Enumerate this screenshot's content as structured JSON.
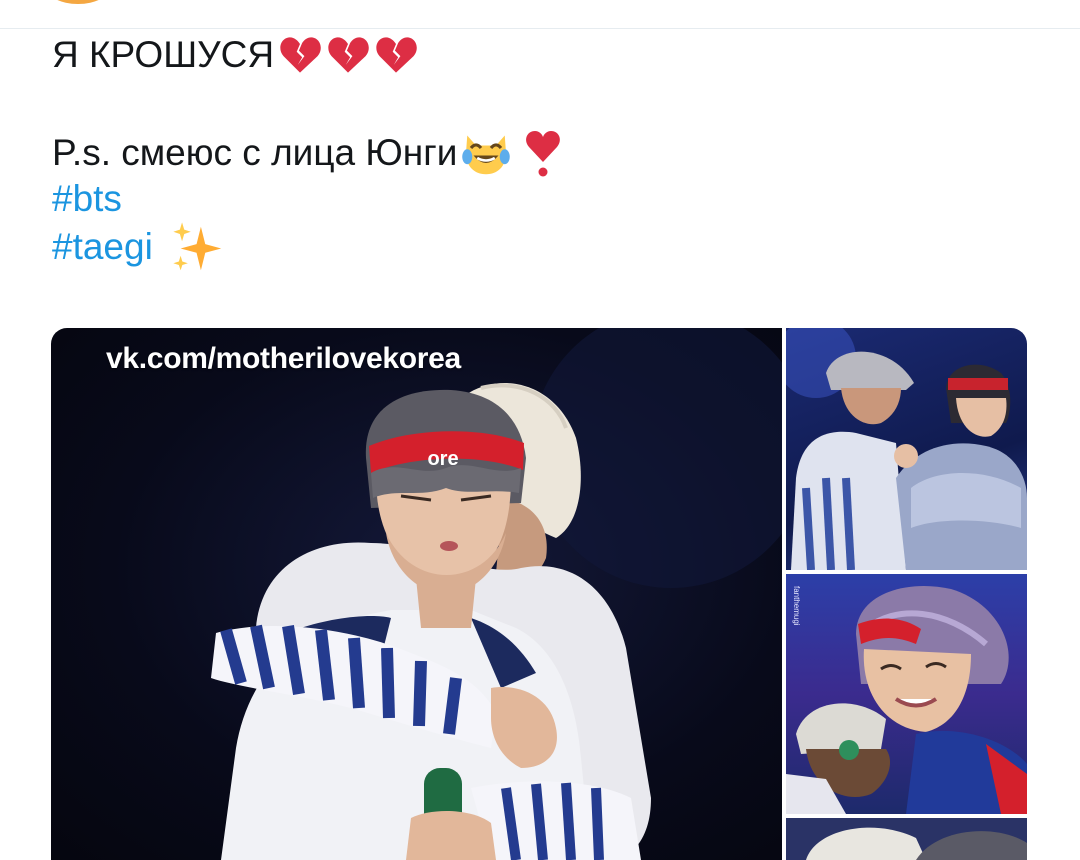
{
  "tweet": {
    "line1": "Я КРОШУСЯ",
    "line1_emojis": [
      "broken-heart-icon",
      "broken-heart-icon",
      "broken-heart-icon"
    ],
    "line2": "P.s. смеюс с лица Юнги",
    "line2_emojis": [
      "cat-tears-of-joy-icon",
      "heart-exclamation-icon"
    ],
    "hashtag1": "#bts",
    "hashtag2": "#taegi",
    "hashtag2_emoji": "sparkles-icon"
  },
  "media": {
    "watermark": "vk.com/motherilovekorea",
    "headband_text": "ore",
    "side_credit": "fanthemugi"
  },
  "colors": {
    "text": "#14171a",
    "hashtag": "#1b95e0",
    "heart_red": "#dd2e44",
    "avatar_ring": "#f4a742"
  }
}
